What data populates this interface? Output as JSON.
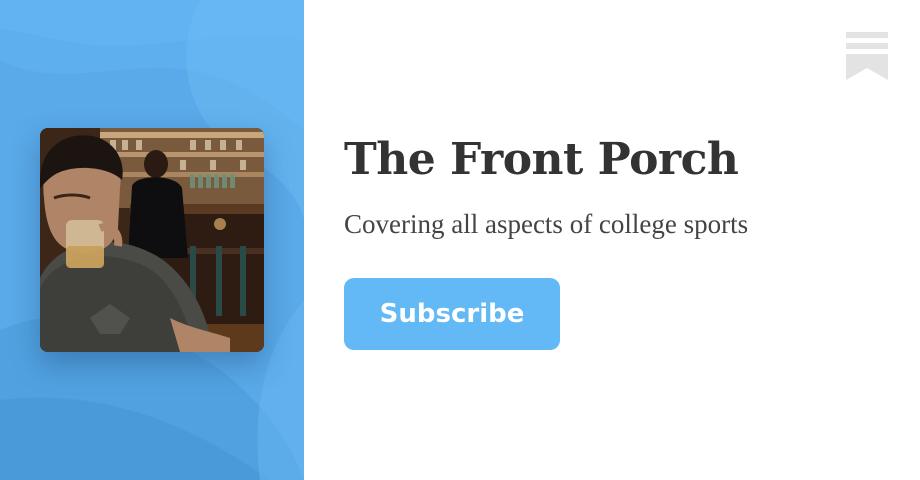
{
  "publication": {
    "title": "The Front Porch",
    "subtitle": "Covering all aspects of college sports"
  },
  "subscribe_button": {
    "label": "Subscribe",
    "background": "#62b9f5"
  },
  "left_panel": {
    "background": "#5aa9e8"
  },
  "avatar": {
    "description_icon": "avatar-photo"
  },
  "logo": {
    "icon": "bookmark-icon",
    "color": "#e3e3e3"
  }
}
